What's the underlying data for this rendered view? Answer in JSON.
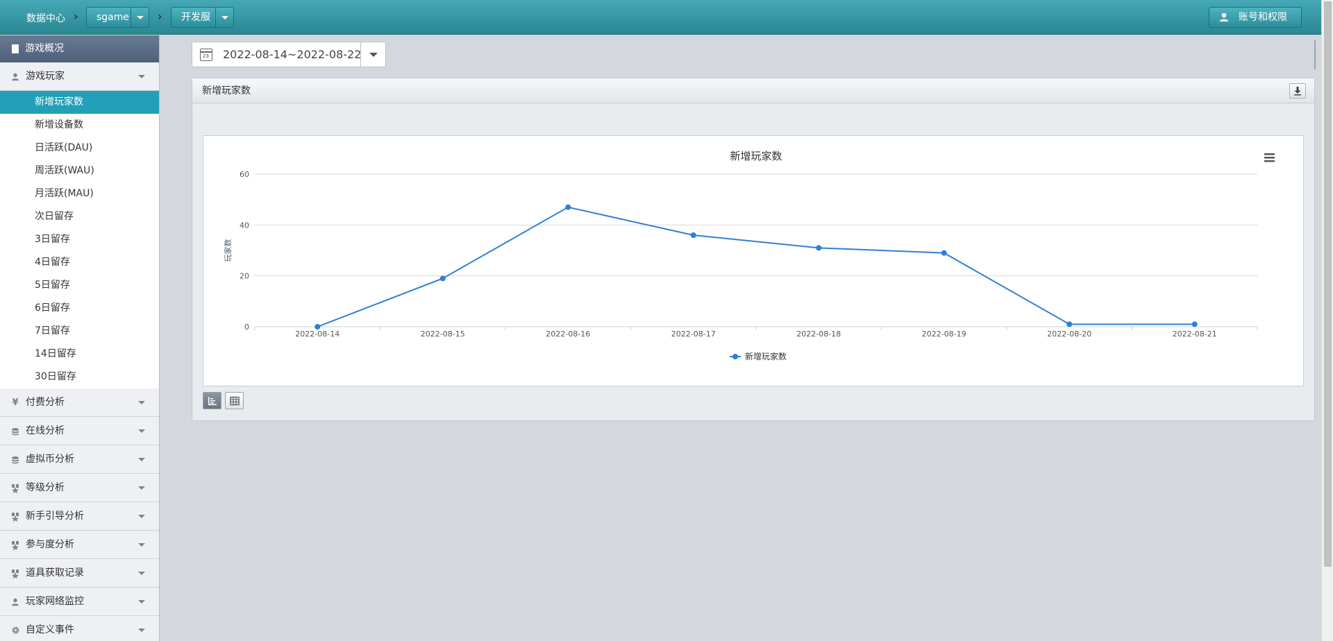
{
  "topbar": {
    "home": "数据中心",
    "game": "sgame",
    "server": "开发服",
    "account": "账号和权限"
  },
  "sidebar": {
    "overview": "游戏概况",
    "player_group": "游戏玩家",
    "player_items": [
      "新增玩家数",
      "新增设备数",
      "日活跃(DAU)",
      "周活跃(WAU)",
      "月活跃(MAU)",
      "次日留存",
      "3日留存",
      "4日留存",
      "5日留存",
      "6日留存",
      "7日留存",
      "14日留存",
      "30日留存"
    ],
    "active_item": "新增玩家数",
    "groups": [
      {
        "label": "付费分析",
        "icon": "yen-icon"
      },
      {
        "label": "在线分析",
        "icon": "database-icon"
      },
      {
        "label": "虚拟币分析",
        "icon": "database-icon"
      },
      {
        "label": "等级分析",
        "icon": "award-icon"
      },
      {
        "label": "新手引导分析",
        "icon": "award-icon"
      },
      {
        "label": "参与度分析",
        "icon": "award-icon"
      },
      {
        "label": "道具获取记录",
        "icon": "award-icon"
      },
      {
        "label": "玩家网络监控",
        "icon": "user-icon"
      },
      {
        "label": "自定义事件",
        "icon": "gear-icon"
      }
    ]
  },
  "date_range": "2022-08-14~2022-08-22",
  "calendar_day": "23",
  "panel": {
    "title": "新增玩家数"
  },
  "chart_data": {
    "type": "line",
    "title": "新增玩家数",
    "ylabel": "玩家数",
    "xlabel": "",
    "categories": [
      "2022-08-14",
      "2022-08-15",
      "2022-08-16",
      "2022-08-17",
      "2022-08-18",
      "2022-08-19",
      "2022-08-20",
      "2022-08-21"
    ],
    "series": [
      {
        "name": "新增玩家数",
        "values": [
          0,
          19,
          47,
          36,
          31,
          29,
          1,
          1
        ],
        "color": "#2f7ed8"
      }
    ],
    "ylim": [
      0,
      60
    ],
    "yticks": [
      0,
      20,
      40,
      60
    ],
    "grid": true,
    "legend": "bottom-center"
  },
  "colors": {
    "accent": "#23a0b7",
    "series": "#2f7ed8"
  }
}
